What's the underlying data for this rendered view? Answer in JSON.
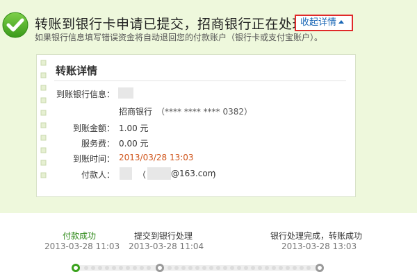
{
  "header": {
    "headline": "转账到银行卡申请已提交，招商银行正在处理。",
    "toggle_label": "收起详情",
    "subline": "如果银行信息填写错误资金将自动退回您的付款账户（银行卡或支付宝账户）。"
  },
  "details": {
    "title": "转账详情",
    "bank_label": "到账银行信息：",
    "bank_name": "招商银行",
    "bank_card": "（**** **** **** 0382）",
    "amount_label": "到账金额：",
    "amount_value": "1.00 元",
    "fee_label": "服务费：",
    "fee_value": "0.00 元",
    "time_label": "到账时间：",
    "time_value": "2013/03/28 13:03",
    "payer_label": "付款人：",
    "payer_open": "（",
    "payer_email_suffix": "@163.com",
    "payer_close": "）"
  },
  "timeline": {
    "steps": [
      {
        "title": "付款成功",
        "time": "2013-03-28 11:03"
      },
      {
        "title": "提交到银行处理",
        "time": "2013-03-28 11:04"
      },
      {
        "title": "银行处理完成，转账成功",
        "time": "2013-03-28 13:03"
      }
    ]
  },
  "colors": {
    "band": "#eef8dc",
    "accent_green": "#3aa21c",
    "link_blue": "#1a67b6",
    "highlight_red": "#e02a2a",
    "time_orange": "#d0541a"
  }
}
